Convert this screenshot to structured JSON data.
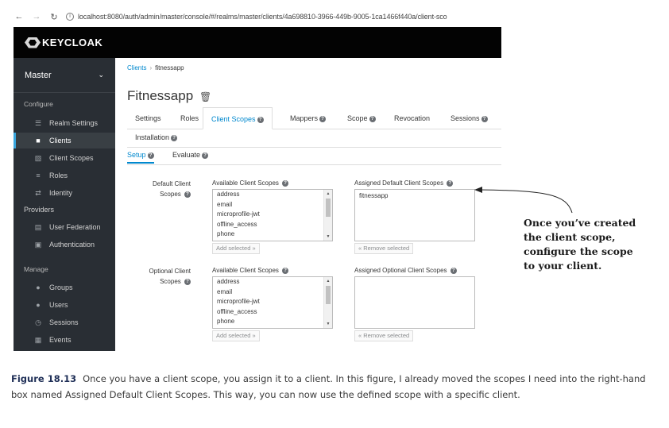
{
  "browser": {
    "url": "localhost:8080/auth/admin/master/console/#/realms/master/clients/4a698810-3966-449b-9005-1ca1466f440a/client-sco"
  },
  "header": {
    "logo_text": "KEYCLOAK"
  },
  "sidebar": {
    "realm": "Master",
    "configure_label": "Configure",
    "configure_items": [
      {
        "label": "Realm Settings",
        "icon": "sliders-icon"
      },
      {
        "label": "Clients",
        "icon": "cube-icon",
        "active": true
      },
      {
        "label": "Client Scopes",
        "icon": "cubes-icon"
      },
      {
        "label": "Roles",
        "icon": "list-icon"
      },
      {
        "label": "Identity",
        "icon": "exchange-icon"
      },
      {
        "label": "Providers"
      },
      {
        "label": "User Federation",
        "icon": "database-icon"
      },
      {
        "label": "Authentication",
        "icon": "lock-icon"
      }
    ],
    "manage_label": "Manage",
    "manage_items": [
      {
        "label": "Groups",
        "icon": "users-icon"
      },
      {
        "label": "Users",
        "icon": "user-icon"
      },
      {
        "label": "Sessions",
        "icon": "clock-icon"
      },
      {
        "label": "Events",
        "icon": "calendar-icon"
      }
    ]
  },
  "breadcrumb": {
    "parent": "Clients",
    "current": "fitnessapp"
  },
  "page_title": "Fitnessapp",
  "tabs": [
    "Settings",
    "Roles",
    "Client Scopes",
    "Mappers",
    "Scope",
    "Revocation",
    "Sessions",
    "Installation"
  ],
  "subtabs": [
    "Setup",
    "Evaluate"
  ],
  "default_section": {
    "label_line1": "Default Client",
    "label_line2": "Scopes",
    "available_header": "Available Client Scopes",
    "available_items": [
      "address",
      "email",
      "microprofile-jwt",
      "offline_access",
      "phone"
    ],
    "add_button": "Add selected »",
    "assigned_header": "Assigned Default Client Scopes",
    "assigned_items": [
      "fitnessapp"
    ],
    "remove_button": "« Remove selected"
  },
  "optional_section": {
    "label_line1": "Optional Client",
    "label_line2": "Scopes",
    "available_header": "Available Client Scopes",
    "available_items": [
      "address",
      "email",
      "microprofile-jwt",
      "offline_access",
      "phone"
    ],
    "add_button": "Add selected »",
    "assigned_header": "Assigned Optional Client Scopes",
    "assigned_items": [],
    "remove_button": "« Remove selected"
  },
  "annotation": {
    "lines": [
      "Once you’ve created",
      "the client scope,",
      "configure the scope",
      "to your client."
    ]
  },
  "caption": {
    "figure": "Figure 18.13",
    "text": "Once you have a client scope, you assign it to a client. In this figure, I already moved the scopes I need into the right-hand box named Assigned Default Client Scopes. This way, you can now use the defined scope with a specific client."
  },
  "colors": {
    "link": "#0088ce",
    "sidebar_bg": "#292e34",
    "header_bg": "#030303"
  }
}
